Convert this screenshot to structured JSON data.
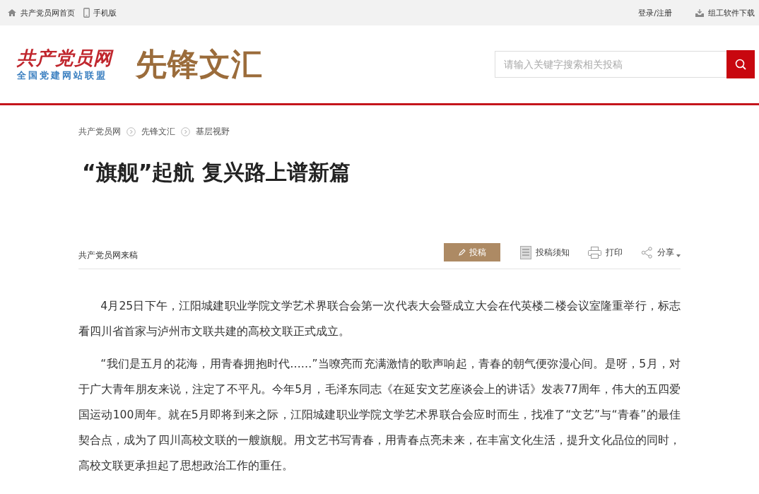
{
  "top_bar": {
    "left": [
      {
        "kind": "home",
        "label": "共产党员网首页"
      },
      {
        "kind": "mobile",
        "label": "手机版"
      }
    ],
    "login": "登录/注册",
    "download": "组工软件下载"
  },
  "header": {
    "logo_main": "共产党员网",
    "logo_sub": "全国党建网站联盟",
    "section_title": "先锋文汇",
    "search": {
      "placeholder": "请输入关键字搜索相关投稿"
    }
  },
  "breadcrumb": [
    "共产党员网",
    "先锋文汇",
    "基层视野"
  ],
  "article": {
    "title": "“旗舰”起航 复兴路上谱新篇",
    "source": "共产党员网来稿",
    "actions": [
      {
        "kind": "submit",
        "label": "投稿"
      },
      {
        "kind": "notice",
        "label": "投稿须知"
      },
      {
        "kind": "print",
        "label": "打印"
      },
      {
        "kind": "share",
        "label": "分享"
      }
    ],
    "paragraphs": [
      "4月25日下午，江阳城建职业学院文学艺术界联合会第一次代表大会暨成立大会在代英楼二楼会议室隆重举行，标志看四川省首家与泸州市文联共建的高校文联正式成立。",
      "“我们是五月的花海，用青春拥抱时代……”当嘹亮而充满激情的歌声响起，青春的朝气便弥漫心间。是呀，5月，对于广大青年朋友来说，注定了不平凡。今年5月，毛泽东同志《在延安文艺座谈会上的讲话》发表77周年，伟大的五四爱国运动100周年。就在5月即将到来之际，江阳城建职业学院文学艺术界联合会应时而生，找准了“文艺”与“青春”的最佳契合点，成为了四川高校文联的一艘旗舰。用文艺书写青春，用青春点亮未来，在丰富文化生活，提升文化品位的同时，高校文联更承担起了思想政治工作的重任。"
    ]
  }
}
